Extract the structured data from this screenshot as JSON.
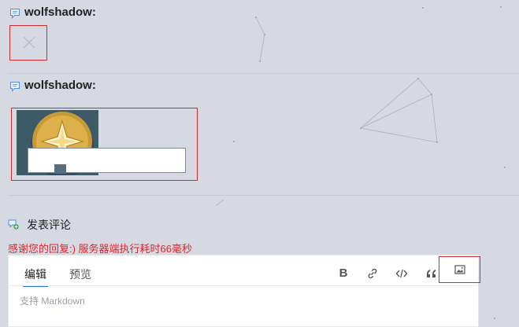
{
  "comments": [
    {
      "user": "wolfshadow:"
    },
    {
      "user": "wolfshadow:"
    }
  ],
  "icons": {
    "comment": "speech-bubble-icon",
    "broken_image": "broken-image-icon",
    "post_comment": "comment-add-icon",
    "bold": "bold-icon",
    "link": "link-icon",
    "code": "code-icon",
    "quote": "quote-icon",
    "image": "image-icon"
  },
  "post_comment": {
    "title": "发表评论"
  },
  "notice": "感谢您的回复:) 服务器端执行耗时66毫秒",
  "editor": {
    "tabs": [
      "编辑",
      "预览"
    ],
    "active_tab": "编辑",
    "bold_label": "B",
    "placeholder": "支持 Markdown"
  },
  "colors": {
    "background": "#d6d9e1",
    "notice": "#e0262b",
    "highlight_border": "#d12c2c",
    "active_tab": "#2b6fd6"
  }
}
